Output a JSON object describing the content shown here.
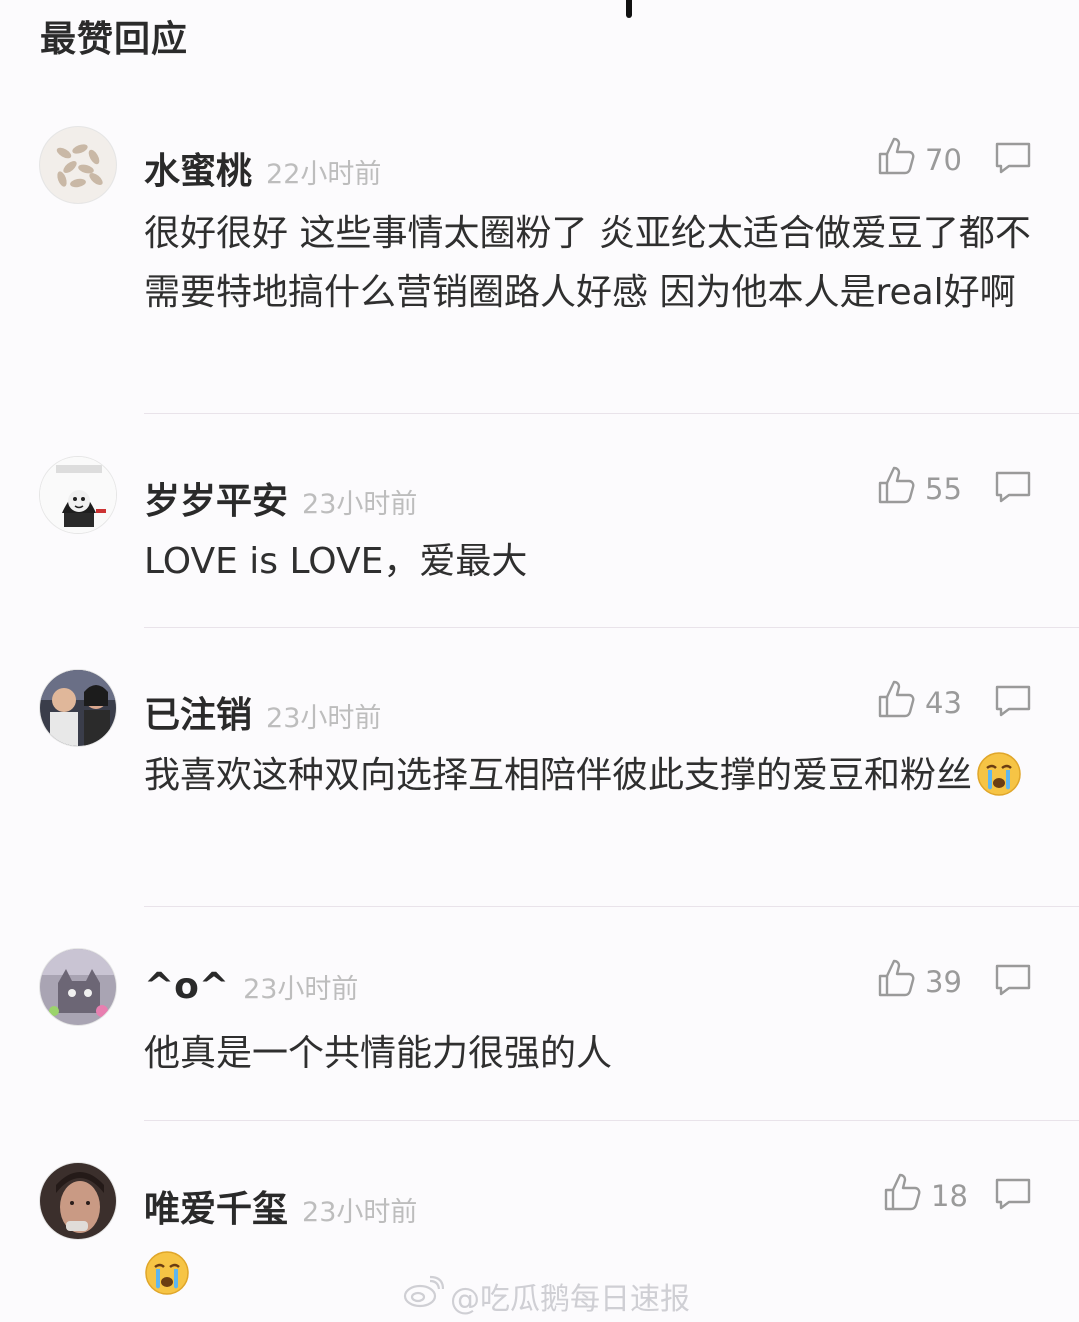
{
  "section_title": "最赞回应",
  "comments": [
    {
      "user": "水蜜桃",
      "time": "22小时前",
      "likes": "70",
      "text": "很好很好 这些事情太圈粉了 炎亚纶太适合做爱豆了都不需要特地搞什么营销圈路人好感 因为他本人是real好啊",
      "avatar": "avatar-sweets"
    },
    {
      "user": "岁岁平安",
      "time": "23小时前",
      "likes": "55",
      "text": "LOVE is LOVE，爱最大",
      "avatar": "avatar-meme"
    },
    {
      "user": "已注销",
      "time": "23小时前",
      "likes": "43",
      "text": "我喜欢这种双向选择互相陪伴彼此支撑的爱豆和粉丝",
      "emoji": "crying-face",
      "avatar": "avatar-photo"
    },
    {
      "user": "^o^",
      "time": "23小时前",
      "likes": "39",
      "text": "他真是一个共情能力很强的人",
      "avatar": "avatar-cat"
    },
    {
      "user": "唯爱千玺",
      "time": "23小时前",
      "likes": "18",
      "text": "",
      "emoji": "crying-face",
      "avatar": "avatar-portrait"
    }
  ],
  "watermark": "@吃瓜鹅每日速报",
  "icons": {
    "like": "thumbs-up-icon",
    "reply": "comment-bubble-icon",
    "watermark": "weibo-logo-icon"
  },
  "colors": {
    "background": "#fcfbfd",
    "time_text": "#bdbdbd",
    "divider": "#e9e3ea",
    "emoji": "#f6c445"
  }
}
